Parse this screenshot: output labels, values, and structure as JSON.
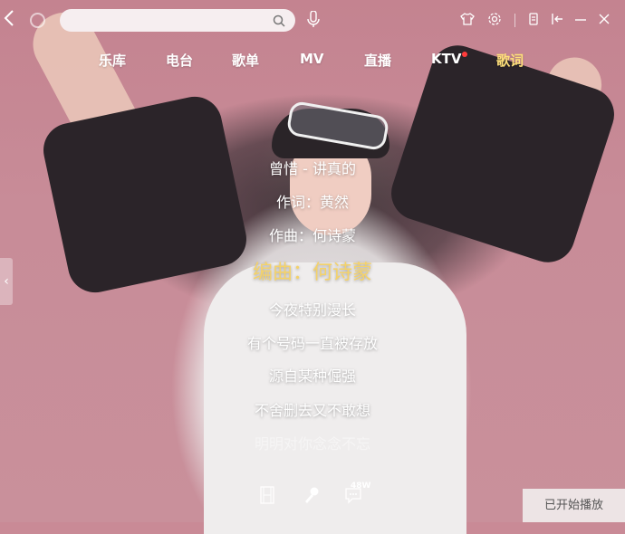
{
  "search": {
    "placeholder": "",
    "value": ""
  },
  "nav": {
    "items": [
      {
        "label": "乐库"
      },
      {
        "label": "电台"
      },
      {
        "label": "歌单"
      },
      {
        "label": "MV"
      },
      {
        "label": "直播"
      },
      {
        "label": "KTV"
      },
      {
        "label": "歌词"
      }
    ],
    "active_index": 6
  },
  "lyrics": {
    "lines": [
      "曾惜 - 讲真的",
      "作词：黄然",
      "作曲：何诗蒙",
      "编曲：何诗蒙",
      "今夜特别漫长",
      "有个号码一直被存放",
      "源自某种倔强",
      "不舍删去又不敢想",
      "明明对你念念不忘"
    ],
    "current_index": 3
  },
  "comments": {
    "count_badge": "48W"
  },
  "status": {
    "toast": "已开始播放"
  },
  "colors": {
    "active_nav": "#ffe07a",
    "current_lyric": "#f4d26a",
    "notify_dot": "#ff3b3b"
  }
}
